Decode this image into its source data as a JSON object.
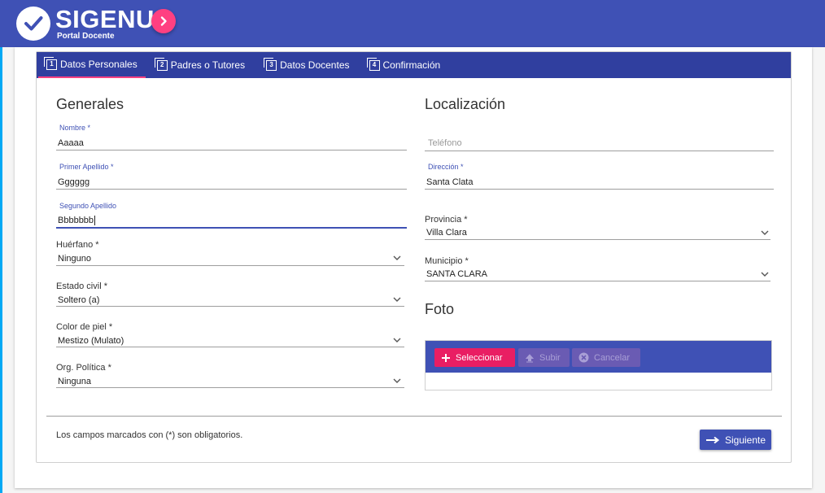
{
  "app": {
    "title": "SIGENU",
    "subtitle": "Portal Docente"
  },
  "tabs": [
    {
      "number": "1",
      "label": "Datos Personales",
      "active": true
    },
    {
      "number": "2",
      "label": "Padres o Tutores",
      "active": false
    },
    {
      "number": "3",
      "label": "Datos Docentes",
      "active": false
    },
    {
      "number": "4",
      "label": "Confirmación",
      "active": false
    }
  ],
  "generales": {
    "title": "Generales",
    "nombre": {
      "label": "Nombre *",
      "value": "Aaaaa"
    },
    "primer_apellido": {
      "label": "Primer Apellido *",
      "value": "Gggggg"
    },
    "segundo_apellido": {
      "label": "Segundo Apellido",
      "value": "Bbbbbbb"
    },
    "huerfano": {
      "label": "Huérfano *",
      "value": "Ninguno"
    },
    "estado_civil": {
      "label": "Estado civil *",
      "value": "Soltero (a)"
    },
    "color_piel": {
      "label": "Color de piel *",
      "value": "Mestizo (Mulato)"
    },
    "org_politica": {
      "label": "Org. Política *",
      "value": "Ninguna"
    }
  },
  "localizacion": {
    "title": "Localización",
    "telefono": {
      "placeholder": "Teléfono"
    },
    "direccion": {
      "label": "Dirección *",
      "value": "Santa Clata"
    },
    "provincia": {
      "label": "Provincia *",
      "value": "Villa Clara"
    },
    "municipio": {
      "label": "Municipio *",
      "value": "SANTA CLARA"
    }
  },
  "foto": {
    "title": "Foto",
    "select_label": "Seleccionar",
    "upload_label": "Subir",
    "cancel_label": "Cancelar"
  },
  "footer": {
    "note": "Los campos marcados con (*) son obligatorios.",
    "next_label": "Siguiente"
  },
  "colors": {
    "primary": "#3f51b5",
    "primary_dark": "#303f9f",
    "accent": "#ff4081",
    "select_button": "#e91e63"
  }
}
